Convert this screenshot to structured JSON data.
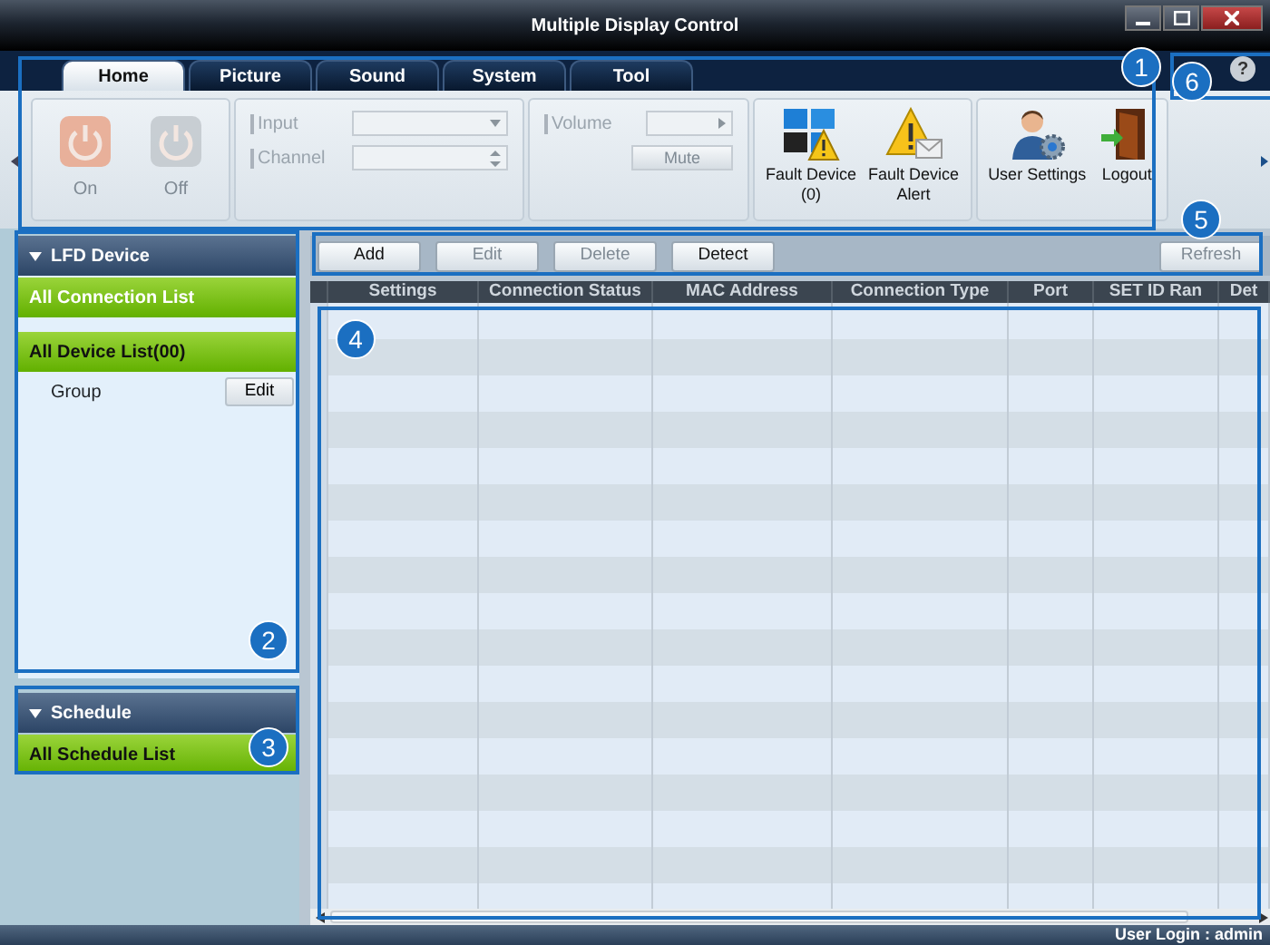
{
  "window": {
    "title": "Multiple Display Control"
  },
  "tabs": [
    {
      "label": "Home",
      "selected": true
    },
    {
      "label": "Picture",
      "selected": false
    },
    {
      "label": "Sound",
      "selected": false
    },
    {
      "label": "System",
      "selected": false
    },
    {
      "label": "Tool",
      "selected": false
    }
  ],
  "ribbon": {
    "power_buttons": [
      {
        "label": "On",
        "kind": "on",
        "disabled": true
      },
      {
        "label": "Off",
        "kind": "off",
        "disabled": true
      }
    ],
    "input": {
      "label": "Input",
      "disabled": true
    },
    "channel": {
      "label": "Channel",
      "disabled": true
    },
    "volume": {
      "label": "Volume",
      "disabled": true
    },
    "mute": {
      "label": "Mute",
      "disabled": true
    },
    "actions": [
      {
        "kind": "fault",
        "label": "Fault Device\n(0)"
      },
      {
        "kind": "alert",
        "label": "Fault Device\nAlert"
      },
      {
        "kind": "user",
        "label": "User Settings"
      },
      {
        "kind": "logout",
        "label": "Logout"
      }
    ]
  },
  "sidebar": {
    "sections": [
      {
        "title": "LFD Device",
        "expanded": true,
        "items": [
          {
            "label": "All Connection List"
          },
          {
            "label": "All Device List(00)"
          }
        ],
        "group": {
          "label": "Group",
          "button": "Edit"
        }
      },
      {
        "title": "Schedule",
        "expanded": true,
        "items": [
          {
            "label": "All Schedule List"
          }
        ]
      }
    ]
  },
  "toolbar": {
    "buttons": [
      {
        "label": "Add",
        "disabled": false
      },
      {
        "label": "Edit",
        "disabled": true
      },
      {
        "label": "Delete",
        "disabled": true
      },
      {
        "label": "Detect",
        "disabled": false
      }
    ],
    "refresh": {
      "label": "Refresh",
      "disabled": true
    }
  },
  "table": {
    "columns": [
      "Settings",
      "Connection Status",
      "MAC Address",
      "Connection Type",
      "Port",
      "SET ID Ran",
      "Det"
    ]
  },
  "help": "?",
  "status_bar": "User Login : admin",
  "callouts": [
    "1",
    "2",
    "3",
    "4",
    "5",
    "6"
  ]
}
